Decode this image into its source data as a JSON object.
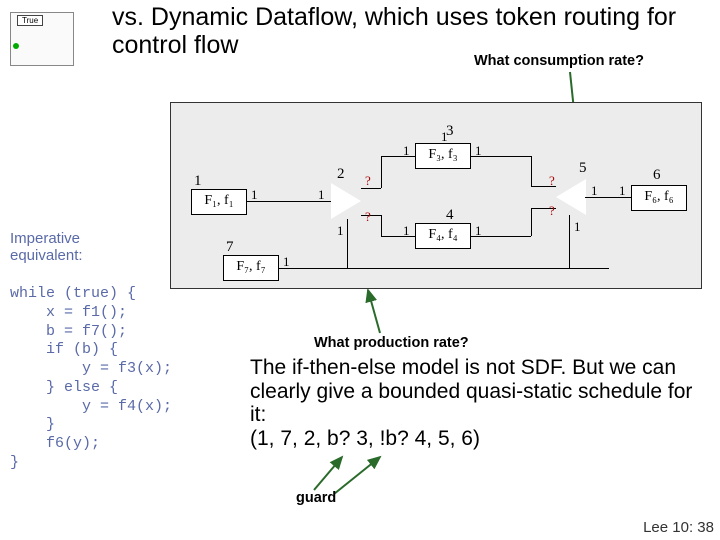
{
  "trueBox": {
    "label": "True"
  },
  "title": "vs. Dynamic Dataflow, which uses token routing for control flow",
  "questions": {
    "consumption": "What consumption rate?",
    "production": "What production rate?"
  },
  "imperative": {
    "label": "Imperative equivalent:",
    "code": "while (true) {\n    x = f1();\n    b = f7();\n    if (b) {\n        y = f3(x);\n    } else {\n        y = f4(x);\n    }\n    f6(y);\n}"
  },
  "explain": {
    "line1": "The if-then-else model is not SDF. But we can clearly give a bounded quasi-static schedule for it:",
    "schedule": "(1, 7, 2, b? 3, !b? 4, 5, 6)"
  },
  "guardLabel": "guard",
  "footer": "Lee 10: 38",
  "diagram": {
    "blocks": {
      "F1": "F₁, f₁",
      "F3": "F₃, f₃",
      "F4": "F₄, f₄",
      "F6": "F₆, f₆",
      "F7": "F₇, f₇"
    },
    "bigLabels": {
      "n1": "1",
      "n2": "2",
      "n3": "3",
      "n4": "4",
      "n5": "5",
      "n6": "6",
      "n7": "7"
    },
    "portRate": "1",
    "unknownRate": "?"
  }
}
